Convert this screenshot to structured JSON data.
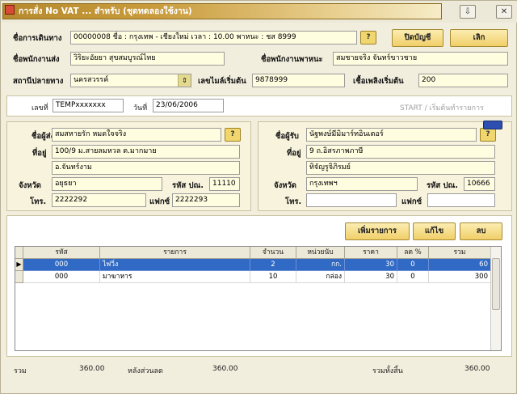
{
  "window": {
    "title": "การสั่ง No VAT ... สำหรับ (ชุดทดลองใช้งาน)",
    "minimize_glyph": "⇩",
    "close_glyph": "✕"
  },
  "trip": {
    "label": "ชื่อการเดินทาง",
    "value": "00000008 ชื่อ : กรุงเทพ - เชียงใหม่  เวลา : 10.00  พาหนะ : ชส 8999",
    "lookup_label": "?",
    "close_button": "ปิดบัญชี",
    "cancel_button": "เลิก"
  },
  "sender_staff": {
    "label": "ชื่อพนักงานส่ง",
    "value": "วิริยะอัยยา  สุขสมบูรณ์ไทย"
  },
  "driver_staff": {
    "label": "ชื่อพนักงานพาหนะ",
    "value": "สมชายจริง จันทร์ขาวชาย"
  },
  "destination": {
    "label": "สถานีปลายทาง",
    "value": "นครสวรรค์"
  },
  "start_mileage": {
    "label": "เลขไมล์เริ่มต้น",
    "value": "9878999"
  },
  "start_fuel": {
    "label": "เชื้อเพลิงเริ่มต้น",
    "value": "200"
  },
  "doc": {
    "no_label": "เลขที่",
    "no_value": "TEMPxxxxxxx",
    "date_label": "วันที่",
    "date_value": "23/06/2006",
    "status": "START / เริ่มต้นทำรายการ"
  },
  "sender": {
    "name_label": "ชื่อผู้ส่ง",
    "name_value": "สมสหายรัก หมดใจจริง",
    "lookup_label": "?",
    "address_label": "ที่อยู่",
    "address1": "100/9 ม.สายลมหวล ต.มากมาย",
    "address2": "อ.จันทร์งาม",
    "province_label": "จังหวัด",
    "province_value": "อยุธยา",
    "zip_label": "รหัส ปณ.",
    "zip_value": "11110",
    "tel_label": "โทร.",
    "tel_value": "2222292",
    "fax_label": "แฟกซ์",
    "fax_value": "2222293"
  },
  "receiver": {
    "name_label": "ชื่อผู้รับ",
    "name_value": "นัฐพงษ์มีมิมาร์ทอินเตอร์",
    "lookup_label": "?",
    "address_label": "ที่อยู่",
    "address1": "9 ถ.อิสรภาพภาษี",
    "address2": "ทิจัญรูจิภิรมย์",
    "province_label": "จังหวัด",
    "province_value": "กรุงเทพฯ",
    "zip_label": "รหัส ปณ.",
    "zip_value": "10666",
    "tel_label": "โทร.",
    "tel_value": "",
    "fax_label": "แฟกซ์",
    "fax_value": ""
  },
  "grid_toolbar": {
    "add": "เพิ่มรายการ",
    "edit": "แก้ไข",
    "delete": "ลบ"
  },
  "grid": {
    "columns": [
      "รหัส",
      "รายการ",
      "จำนวน",
      "หน่วยนับ",
      "ราคา",
      "ลด %",
      "รวม"
    ],
    "rows": [
      {
        "code": "000",
        "item": "ไฟวิ่ง",
        "qty": "2",
        "unit": "กก.",
        "price": "30",
        "discount": "0",
        "total": "60"
      },
      {
        "code": "000",
        "item": "มาฆาหาร",
        "qty": "10",
        "unit": "กล่อง",
        "price": "30",
        "discount": "0",
        "total": "300"
      }
    ]
  },
  "summary": {
    "total_label": "รวม",
    "total_value": "360.00",
    "after_discount_label": "หลังส่วนลด",
    "after_discount_value": "360.00",
    "grand_total_label": "รวมทั้งสิ้น",
    "grand_total_value": "360.00"
  }
}
